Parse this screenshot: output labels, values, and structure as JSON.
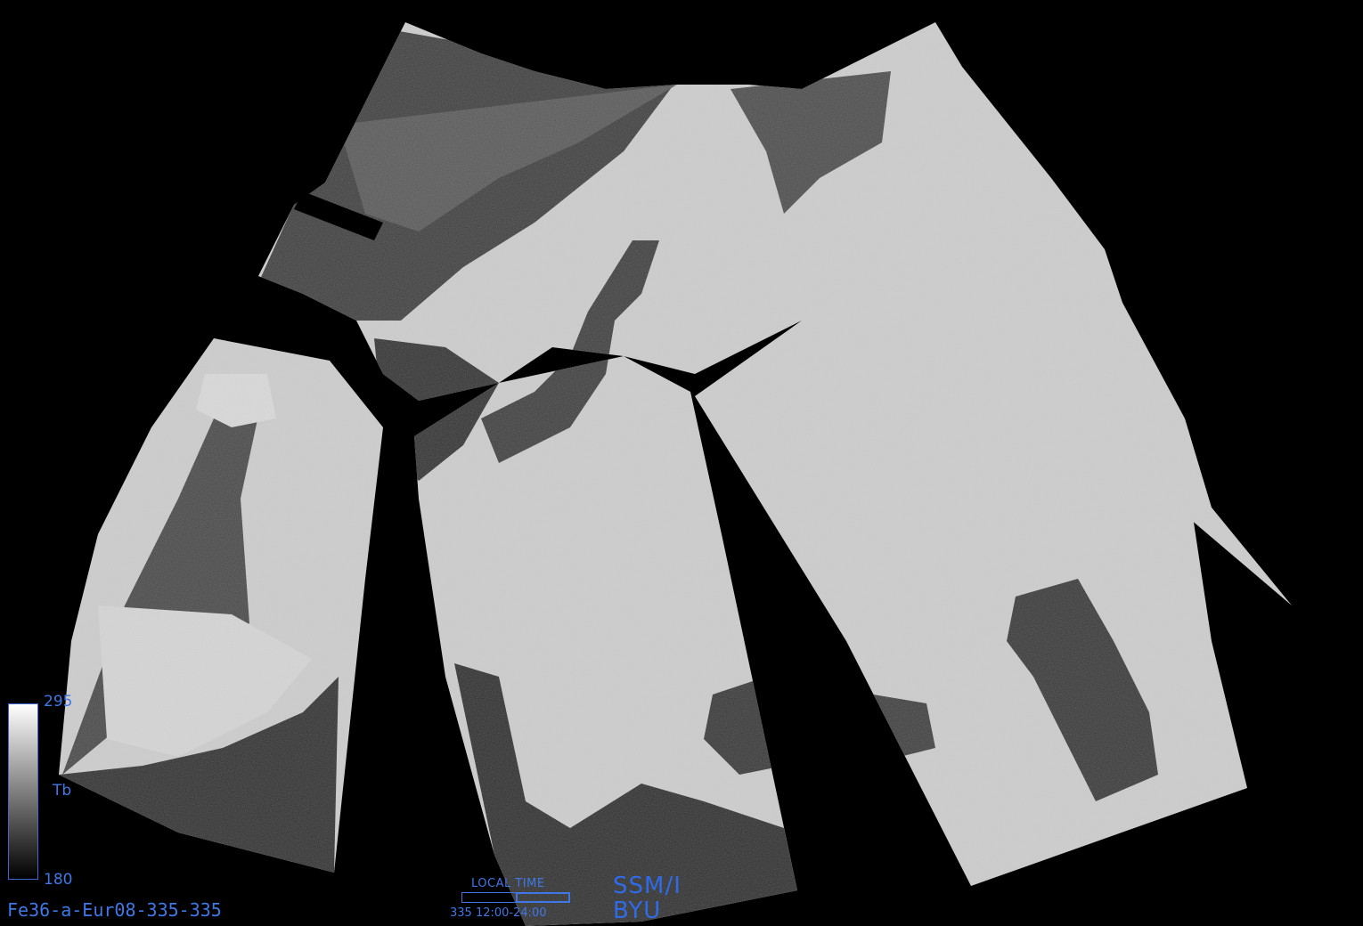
{
  "image_id": "Fe36-a-Eur08-335-335",
  "colorbar": {
    "max_label": "295",
    "min_label": "180",
    "unit_label": "Tb",
    "gradient": [
      "#ffffff",
      "#000000"
    ]
  },
  "local_time": {
    "title": "LOCAL TIME",
    "range_label": "335 12:00-24:00",
    "window_fraction_start": 0.5,
    "window_fraction_end": 1.0
  },
  "sensor_label": "SSM/I",
  "org_label": "BYU",
  "colors": {
    "background": "#000000",
    "annotation": "#3f78e6",
    "land_bright": "#d8d8d8",
    "water_dark": "#2a2a2a"
  }
}
